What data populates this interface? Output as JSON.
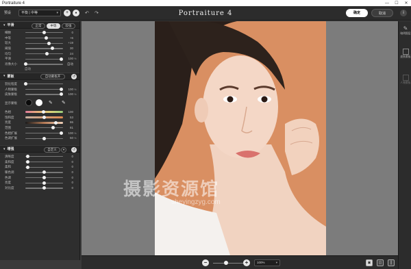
{
  "window": {
    "title": "Portraiture 4",
    "minimize": "—",
    "maximize": "☐",
    "close": "✕"
  },
  "toolbar": {
    "preset_label": "预设",
    "preset_value": "平衡 | 中等",
    "add": "+",
    "remove": "●",
    "undo": "↶",
    "redo": "↷",
    "app_title": "Portraiture 4",
    "ok": "确定",
    "cancel": "取消",
    "info": "i"
  },
  "smoothing": {
    "title": "平滑",
    "modes": [
      "正常",
      "中等",
      "较强"
    ],
    "active_mode": 1,
    "sliders": [
      {
        "label": "细致",
        "value": "0",
        "pos": 0.5
      },
      {
        "label": "中等",
        "value": "+6",
        "pos": 0.55
      },
      {
        "label": "较大",
        "value": "+19",
        "pos": 0.62
      },
      {
        "label": "阈值",
        "value": "30",
        "pos": 0.72
      },
      {
        "label": "均匀",
        "value": "24",
        "pos": 0.58
      },
      {
        "label": "平滑",
        "value": "100",
        "pos": 0.96
      },
      {
        "label": "肖像大小",
        "value": "自动",
        "pos": 0.0
      }
    ],
    "auto_label": "自动"
  },
  "mask": {
    "title": "蒙板",
    "auto_button": "自动蒙板开",
    "sliders": [
      {
        "label": "羽化程度",
        "value": "",
        "pos": 0.0
      },
      {
        "label": "人物蒙板",
        "value": "100",
        "pos": 0.96
      },
      {
        "label": "皮肤蒙板",
        "value": "100",
        "pos": 0.96
      }
    ],
    "show_mask_label": "显示蒙板",
    "color_sliders": [
      {
        "label": "色相",
        "value": "100",
        "pos": 0.48,
        "gradient": "linear-gradient(90deg,#e07a9a,#e9b07a,#e0d27a,#9ad07a)"
      },
      {
        "label": "饱和度",
        "value": "53",
        "pos": 0.5,
        "gradient": "linear-gradient(90deg,#c8b0a0,#e08a50)"
      },
      {
        "label": "亮度",
        "value": "86",
        "pos": 0.8,
        "gradient": "linear-gradient(90deg,#1a1a1a,#b57a55,#f0d0b8)"
      },
      {
        "label": "范围",
        "value": "81",
        "pos": 0.74,
        "gradient": ""
      },
      {
        "label": "色相扩展",
        "value": "100",
        "pos": 0.96,
        "gradient": ""
      },
      {
        "label": "色调扩展",
        "value": "50",
        "pos": 0.5,
        "gradient": ""
      }
    ]
  },
  "enhance": {
    "title": "增强",
    "preset": "自定义",
    "sliders": [
      {
        "label": "清晰度",
        "value": "0",
        "pos": 0.06
      },
      {
        "label": "柔和度",
        "value": "0",
        "pos": 0.06
      },
      {
        "label": "柔和",
        "value": "0",
        "pos": 0.06
      },
      {
        "label": "暖色调",
        "value": "0",
        "pos": 0.5
      },
      {
        "label": "色调",
        "value": "0",
        "pos": 0.5
      },
      {
        "label": "亮度",
        "value": "0",
        "pos": 0.5
      },
      {
        "label": "对比度",
        "value": "0",
        "pos": 0.5
      }
    ]
  },
  "canvas": {
    "watermark": "摄影资源馆",
    "watermark_sub": "sheyingzyg.com"
  },
  "right_panel": [
    {
      "label": "暗明图层"
    },
    {
      "label": "皮肤蒙板"
    },
    {
      "label": "人物蒙板"
    }
  ],
  "bottom": {
    "zoom_out": "−",
    "zoom_in": "+",
    "zoom": "100%",
    "zoom_level": 0.42
  },
  "colors": {
    "background": "#3a3a3a",
    "panel": "#2e2e2e",
    "canvas": "#7c7c7c",
    "photo_bg": "#d98f62"
  }
}
